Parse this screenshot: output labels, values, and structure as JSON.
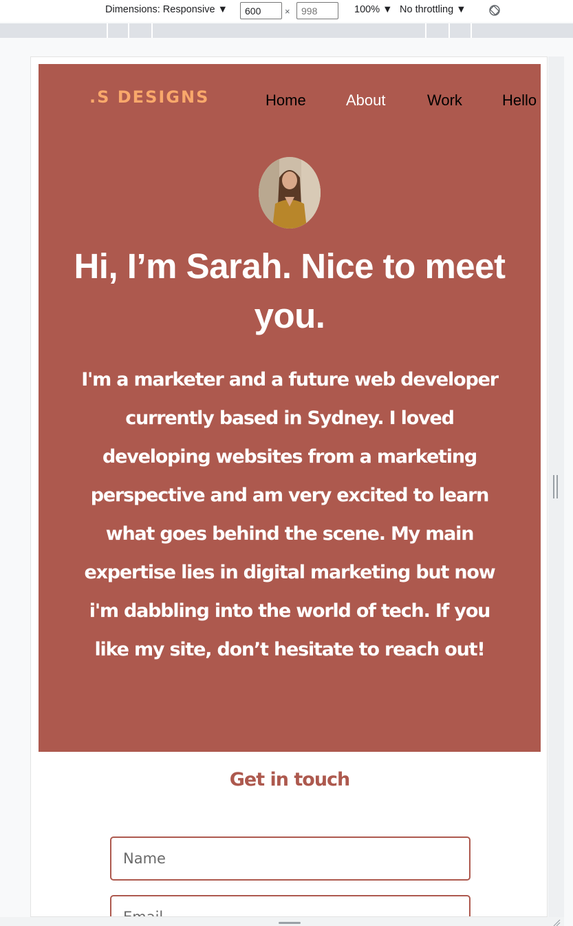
{
  "devtools": {
    "dimensions_label": "Dimensions: Responsive ▼",
    "width_value": "600",
    "height_placeholder": "998",
    "times_sign": "×",
    "zoom_label": "100% ▼",
    "throttling_label": "No throttling ▼",
    "rotate_icon": "rotate-icon"
  },
  "site": {
    "logo": ".S DESIGNS",
    "nav": {
      "home": "Home",
      "about": "About",
      "work": "Work",
      "hello": "Hello"
    },
    "hero": {
      "title": "Hi, I’m Sarah. Nice to meet you.",
      "bio": "I'm a marketer and a future web developer currently based in Sydney. I loved developing websites from a marketing perspective and am very excited to learn what goes behind the scene. My main expertise lies in digital marketing but now i'm dabbling into the world of tech. If you like my site, don’t hesitate to reach out!"
    },
    "contact": {
      "title": "Get in touch",
      "name_placeholder": "Name",
      "email_placeholder": "Email"
    }
  },
  "colors": {
    "hero_bg": "#ad594e",
    "logo": "#f9a86b",
    "nav_active": "#ffffff",
    "nav_default": "#000000",
    "field_border": "#ad594e"
  }
}
